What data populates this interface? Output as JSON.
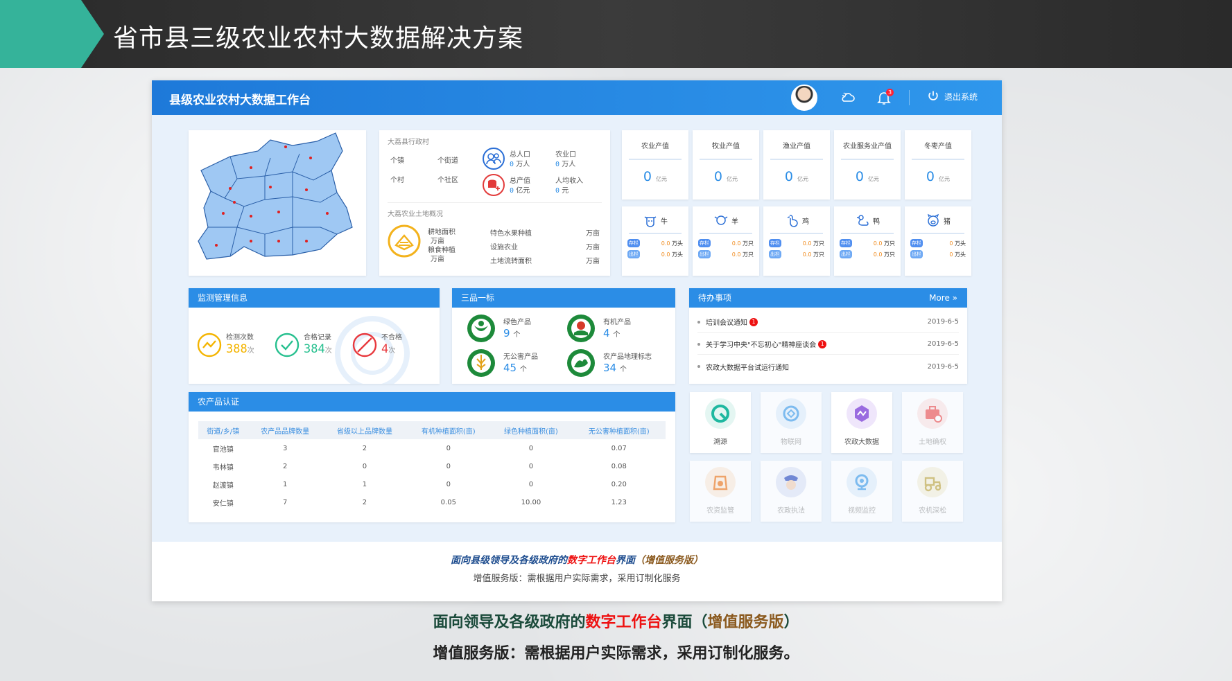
{
  "slide": {
    "title": "省市县三级农业农村大数据解决方案"
  },
  "app": {
    "title": "县级农业农村大数据工作台",
    "notif_count": "3",
    "logout": "退出系统"
  },
  "admin": {
    "title": "大荔县行政村",
    "labels": [
      "个镇",
      "个街道",
      "个村",
      "个社区"
    ],
    "pop_label": "总人口",
    "pop_val": "0",
    "pop_unit": "万人",
    "farm_pop_label": "农业口",
    "farm_pop_val": "0",
    "farm_pop_unit": "万人",
    "gdp_label": "总产值",
    "gdp_val": "0",
    "gdp_unit": "亿元",
    "income_label": "人均收入",
    "income_val": "0",
    "income_unit": "元"
  },
  "land": {
    "title": "大荔农业土地概况",
    "items": [
      {
        "label": "耕地面积",
        "unit": "万亩"
      },
      {
        "label": "粮食种植",
        "unit": "万亩"
      },
      {
        "label": "特色水果种植",
        "unit": "万亩"
      },
      {
        "label": "设施农业",
        "unit": "万亩"
      },
      {
        "label": "土地流转面积",
        "unit": "万亩"
      }
    ]
  },
  "output": [
    {
      "label": "农业产值",
      "value": "0",
      "unit": "亿元"
    },
    {
      "label": "牧业产值",
      "value": "0",
      "unit": "亿元"
    },
    {
      "label": "渔业产值",
      "value": "0",
      "unit": "亿元"
    },
    {
      "label": "农业服务业产值",
      "value": "0",
      "unit": "亿元"
    },
    {
      "label": "冬枣产值",
      "value": "0",
      "unit": "亿元"
    }
  ],
  "livestock": [
    {
      "name": "牛",
      "stock": "0.0",
      "out": "0.0",
      "unit": "万头"
    },
    {
      "name": "羊",
      "stock": "0.0",
      "out": "0.0",
      "unit": "万只"
    },
    {
      "name": "鸡",
      "stock": "0.0",
      "out": "0.0",
      "unit": "万只"
    },
    {
      "name": "鸭",
      "stock": "0.0",
      "out": "0.0",
      "unit": "万只"
    },
    {
      "name": "猪",
      "stock": "0",
      "out": "0",
      "unit": "万头"
    }
  ],
  "tags": {
    "stock": "存栏",
    "out": "出栏"
  },
  "monitor": {
    "title": "监测管理信息",
    "items": [
      {
        "label": "检测次数",
        "value": "388",
        "unit": "次",
        "color": "#f4b400"
      },
      {
        "label": "合格记录",
        "value": "384",
        "unit": "次",
        "color": "#27c08f"
      },
      {
        "label": "不合格",
        "value": "4",
        "unit": "次",
        "color": "#e8383d"
      }
    ]
  },
  "sanpin": {
    "title": "三品一标",
    "items": [
      {
        "label": "绿色产品",
        "value": "9",
        "unit": "个"
      },
      {
        "label": "有机产品",
        "value": "4",
        "unit": "个"
      },
      {
        "label": "无公害产品",
        "value": "45",
        "unit": "个"
      },
      {
        "label": "农产品地理标志",
        "value": "34",
        "unit": "个"
      }
    ]
  },
  "todo": {
    "title": "待办事项",
    "more": "More",
    "items": [
      {
        "text": "培训会议通知",
        "flag": "1",
        "date": "2019-6-5"
      },
      {
        "text": "关于学习中央\"不忘初心\"精神座谈会",
        "flag": "1",
        "date": "2019-6-5"
      },
      {
        "text": "农政大数据平台试运行通知",
        "flag": "",
        "date": "2019-6-5"
      }
    ]
  },
  "cert": {
    "title": "农产品认证",
    "headers": [
      "街道/乡/镇",
      "农产品品牌数量",
      "省级以上品牌数量",
      "有机种植面积(亩)",
      "绿色种植面积(亩)",
      "无公害种植面积(亩)"
    ],
    "rows": [
      [
        "官池镇",
        "3",
        "2",
        "0",
        "0",
        "0.07"
      ],
      [
        "韦林镇",
        "2",
        "0",
        "0",
        "0",
        "0.08"
      ],
      [
        "赵渡镇",
        "1",
        "1",
        "0",
        "0",
        "0.20"
      ],
      [
        "安仁镇",
        "7",
        "2",
        "0.05",
        "10.00",
        "1.23"
      ]
    ]
  },
  "apps": [
    {
      "label": "溯源",
      "color": "#1fb8a0"
    },
    {
      "label": "物联网",
      "color": "#5aa9ec"
    },
    {
      "label": "农政大数据",
      "color": "#9a6be0"
    },
    {
      "label": "土地确权",
      "color": "#ef6a6a"
    },
    {
      "label": "农资监管",
      "color": "#f08a3a"
    },
    {
      "label": "农政执法",
      "color": "#4a66c8"
    },
    {
      "label": "视频监控",
      "color": "#5aa9ec"
    },
    {
      "label": "农机深松",
      "color": "#c7b25a"
    }
  ],
  "caption": {
    "a": "面向县级领导及各级政府的",
    "b": "数字工作台",
    "c": "界面",
    "d": "（增值服务版）",
    "sub": "增值服务版：需根据用户实际需求，采用订制化服务"
  },
  "footer": {
    "a": "面向领导及各级政府的",
    "b": "数字工作台",
    "c": "界面（",
    "d": "增值服务版",
    "e": "）",
    "line2": "增值服务版：需根据用户实际需求，采用订制化服务。"
  }
}
